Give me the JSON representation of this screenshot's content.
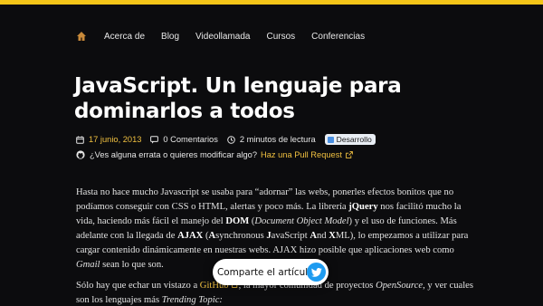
{
  "nav": {
    "logo_icon": "home-logo-icon",
    "links": [
      "Acerca de",
      "Blog",
      "Videollamada",
      "Cursos",
      "Conferencias"
    ]
  },
  "article": {
    "title": "JavaScript. Un lenguaje para dominarlos a todos",
    "date": "17 junio, 2013",
    "comments": "0 Comentarios",
    "reading_time": "2 minutos de lectura",
    "category": "Desarrollo",
    "errata_text": "¿Ves alguna errata o quieres modificar algo?",
    "errata_link": "Haz una Pull Request"
  },
  "body": {
    "p1": [
      {
        "t": "Hasta no hace mucho Javascript se usaba para “adornar” las webs, ponerles efectos bonitos que no podíamos conseguir con CSS o HTML, alertas y poco más. La librería "
      },
      {
        "t": "jQuery",
        "s": "b"
      },
      {
        "t": " nos facilitó mucho la vida, haciendo más fácil el manejo del "
      },
      {
        "t": "DOM",
        "s": "b"
      },
      {
        "t": " ("
      },
      {
        "t": "Document Object Model",
        "s": "i"
      },
      {
        "t": ") y el uso de funciones. Más adelante con la llegada de "
      },
      {
        "t": "AJAX",
        "s": "b"
      },
      {
        "t": " ("
      },
      {
        "t": "A",
        "s": "b"
      },
      {
        "t": "synchronous "
      },
      {
        "t": "J",
        "s": "b"
      },
      {
        "t": "avaScript "
      },
      {
        "t": "A",
        "s": "b"
      },
      {
        "t": "nd "
      },
      {
        "t": "X",
        "s": "b"
      },
      {
        "t": "ML), lo empezamos a utilizar para cargar contenido dinámicamente en nuestras webs. AJAX hizo posible que aplicaciones web como "
      },
      {
        "t": "Gmail",
        "s": "i"
      },
      {
        "t": " sean lo que son."
      }
    ],
    "p2": [
      {
        "t": "Sólo hay que echar un vistazo a "
      },
      {
        "t": "GitHub",
        "s": "link"
      },
      {
        "t": ", la mayor comunidad de proyectos "
      },
      {
        "t": "OpenSource",
        "s": "i"
      },
      {
        "t": ", y ver cuales son los lenguajes más "
      },
      {
        "t": "Trending Topic:",
        "s": "i"
      }
    ]
  },
  "share": {
    "label": "Comparte el artículo",
    "icon": "twitter-icon",
    "color": "#1d9bf0"
  },
  "colors": {
    "background": "#0c0c0e",
    "accent": "#f0c040",
    "topbar": "#f5c518"
  }
}
